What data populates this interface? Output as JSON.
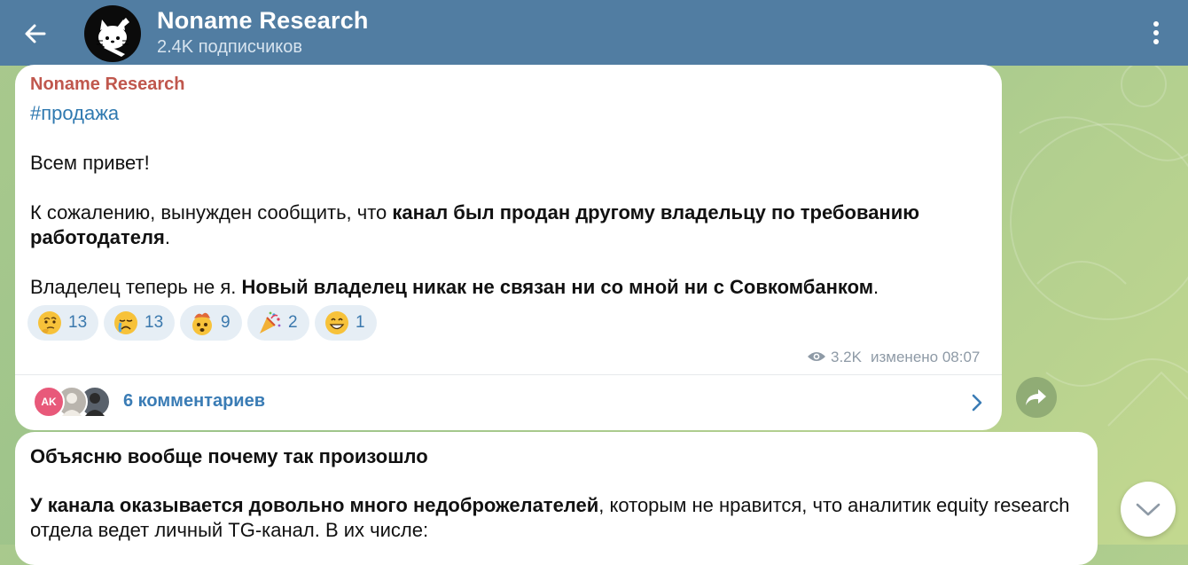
{
  "header": {
    "channel_name": "Noname Research",
    "subscribers": "2.4K подписчиков",
    "back_icon": "arrow-left-icon",
    "menu_icon": "more-vertical-icon",
    "color": "#517da2"
  },
  "post": {
    "sender": "Noname Research",
    "hashtag": "#продажа",
    "greeting": "Всем привет!",
    "p2_start": "К сожалению, вынужден сообщить, что ",
    "p2_bold": "канал был продан другому владельцу по требованию работодателя",
    "p2_end": ".",
    "p3_start": "Владелец теперь не я. ",
    "p3_bold": "Новый владелец никак не связан ни со мной ни с Совкомбанком",
    "p3_end": ".",
    "reactions": [
      {
        "emoji": "thinking-face-icon",
        "count": "13"
      },
      {
        "emoji": "crying-face-icon",
        "count": "13"
      },
      {
        "emoji": "exploding-head-icon",
        "count": "9"
      },
      {
        "emoji": "party-popper-icon",
        "count": "2"
      },
      {
        "emoji": "grinning-face-icon",
        "count": "1"
      }
    ],
    "views": "3.2K",
    "edited": "изменено 08:07",
    "comments": "6 комментариев",
    "commenter_initials": "AK"
  },
  "next_post": {
    "line1": "Объясню вообще почему так произошло",
    "p2_bold": "У канала оказывается довольно много недоброжелателей",
    "p2_rest": ", которым не нравится, что аналитик equity research отдела ведет личный TG-канал. В их числе:"
  },
  "colors": {
    "sender": "#c0574d",
    "link": "#3a7cb5",
    "reaction_bg": "#e6eef5"
  }
}
